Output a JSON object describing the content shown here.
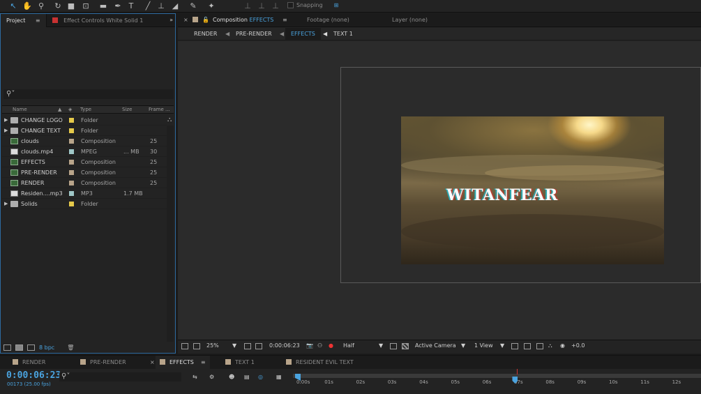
{
  "toolbar": {
    "tools": [
      "selection-tool",
      "hand-tool",
      "zoom-tool",
      "rotate-tool",
      "camera-tool",
      "pan-behind-tool",
      "rectangle-tool",
      "pen-tool",
      "type-tool",
      "brush-tool",
      "clone-stamp-tool",
      "eraser-tool",
      "roto-brush-tool",
      "puppet-tool"
    ],
    "snapping_label": "Snapping"
  },
  "project_panel": {
    "tab_project": "Project",
    "tab_effect_controls": "Effect Controls White Solid 1",
    "search_placeholder": "",
    "columns": {
      "name": "Name",
      "type": "Type",
      "size": "Size",
      "frame": "Frame ..."
    },
    "items": [
      {
        "name": "CHANGE LOGO",
        "kind": "folder",
        "label_color": "#e5c94a",
        "type": "Folder",
        "size": "",
        "frame": ""
      },
      {
        "name": "CHANGE TEXT",
        "kind": "folder",
        "label_color": "#e5c94a",
        "type": "Folder",
        "size": "",
        "frame": ""
      },
      {
        "name": "clouds",
        "kind": "comp",
        "label_color": "#b8a48a",
        "type": "Composition",
        "size": "",
        "frame": "25"
      },
      {
        "name": "clouds.mp4",
        "kind": "media",
        "label_color": "#9fc7c7",
        "type": "MPEG",
        "size": "... MB",
        "frame": "30"
      },
      {
        "name": "EFFECTS",
        "kind": "comp",
        "label_color": "#b8a48a",
        "type": "Composition",
        "size": "",
        "frame": "25"
      },
      {
        "name": "PRE-RENDER",
        "kind": "comp",
        "label_color": "#b8a48a",
        "type": "Composition",
        "size": "",
        "frame": "25"
      },
      {
        "name": "RENDER",
        "kind": "comp",
        "label_color": "#b8a48a",
        "type": "Composition",
        "size": "",
        "frame": "25"
      },
      {
        "name": "Residen....mp3",
        "kind": "media",
        "label_color": "#9fc7c7",
        "type": "MP3",
        "size": "1.7 MB",
        "frame": ""
      },
      {
        "name": "Solids",
        "kind": "folder",
        "label_color": "#e5c94a",
        "type": "Folder",
        "size": "",
        "frame": ""
      }
    ],
    "bpc_label": "8 bpc"
  },
  "viewer": {
    "tab_comp_prefix": "Composition",
    "tab_comp_name": "EFFECTS",
    "tab_footage": "Footage (none)",
    "tab_layer": "Layer (none)",
    "flowchart": [
      "RENDER",
      "PRE-RENDER",
      "EFFECTS",
      "TEXT 1"
    ],
    "comp_text": "WITANFEAR",
    "zoom": "25%",
    "timecode": "0:00:06:23",
    "resolution": "Half",
    "camera": "Active Camera",
    "views": "1 View",
    "exposure": "+0.0"
  },
  "timeline": {
    "tabs": [
      "RENDER",
      "PRE-RENDER",
      "EFFECTS",
      "TEXT 1",
      "RESIDENT EVIL TEXT"
    ],
    "active_tab": "EFFECTS",
    "timecode": "0:00:06:23",
    "frames_info": "00173 (25.00 fps)",
    "ruler_ticks": [
      "0:00s",
      "01s",
      "02s",
      "03s",
      "04s",
      "05s",
      "06s",
      "07s",
      "08s",
      "09s",
      "10s",
      "11s",
      "12s"
    ],
    "playhead_seconds": 6.92
  },
  "colors": {
    "accent": "#4aa3df",
    "folder_label": "#e5c94a",
    "comp_label": "#b8a48a",
    "media_label": "#9fc7c7",
    "effect_controls_swatch": "#c83232"
  }
}
